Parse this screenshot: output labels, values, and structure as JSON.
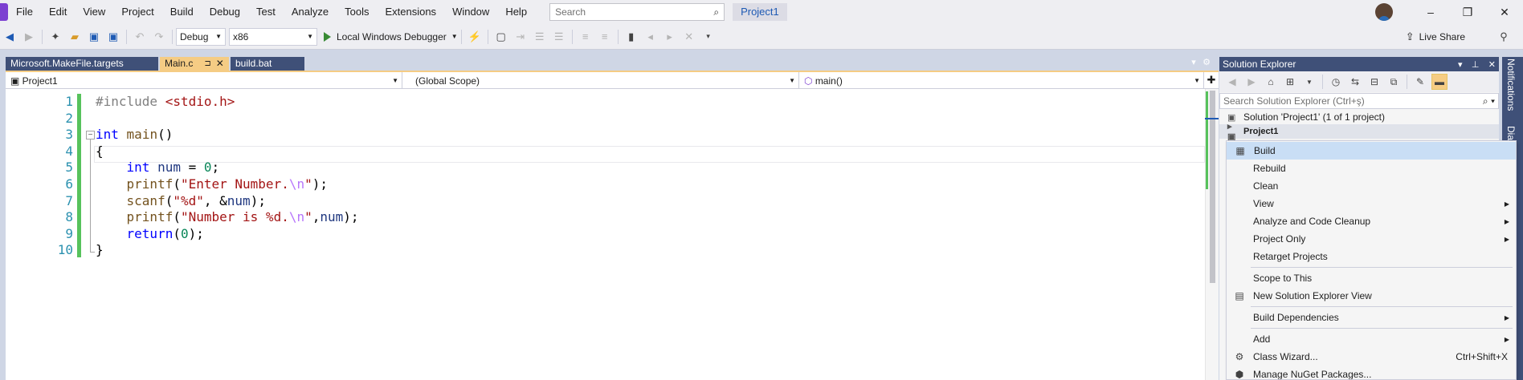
{
  "menubar": {
    "items": [
      "File",
      "Edit",
      "View",
      "Project",
      "Build",
      "Debug",
      "Test",
      "Analyze",
      "Tools",
      "Extensions",
      "Window",
      "Help"
    ],
    "search_placeholder": "Search",
    "project_title": "Project1"
  },
  "toolbar": {
    "configuration": "Debug",
    "platform": "x86",
    "debugger_label": "Local Windows Debugger",
    "live_share": "Live Share"
  },
  "tabs": [
    {
      "label": "Microsoft.MakeFile.targets"
    },
    {
      "label": "Main.c"
    },
    {
      "label": "build.bat"
    }
  ],
  "navbar": {
    "project": "Project1",
    "scope": "(Global Scope)",
    "member": "main()"
  },
  "editor": {
    "line_numbers": [
      "1",
      "2",
      "3",
      "4",
      "5",
      "6",
      "7",
      "8",
      "9",
      "10"
    ],
    "lines": [
      [
        {
          "t": "#include ",
          "c": "pre"
        },
        {
          "t": "<stdio.h>",
          "c": "str"
        }
      ],
      [],
      [
        {
          "t": "int",
          "c": "kw"
        },
        {
          "t": " ",
          "c": ""
        },
        {
          "t": "main",
          "c": "fn"
        },
        {
          "t": "()",
          "c": ""
        }
      ],
      [
        {
          "t": "{",
          "c": ""
        }
      ],
      [
        {
          "t": "    ",
          "c": ""
        },
        {
          "t": "int",
          "c": "kw"
        },
        {
          "t": " ",
          "c": ""
        },
        {
          "t": "num",
          "c": "var"
        },
        {
          "t": " = ",
          "c": ""
        },
        {
          "t": "0",
          "c": "num"
        },
        {
          "t": ";",
          "c": ""
        }
      ],
      [
        {
          "t": "    ",
          "c": ""
        },
        {
          "t": "printf",
          "c": "fn"
        },
        {
          "t": "(",
          "c": ""
        },
        {
          "t": "\"Enter Number.",
          "c": "str"
        },
        {
          "t": "\\n",
          "c": "esc"
        },
        {
          "t": "\"",
          "c": "str"
        },
        {
          "t": ");",
          "c": ""
        }
      ],
      [
        {
          "t": "    ",
          "c": ""
        },
        {
          "t": "scanf",
          "c": "fn"
        },
        {
          "t": "(",
          "c": ""
        },
        {
          "t": "\"%d\"",
          "c": "str"
        },
        {
          "t": ", &",
          "c": ""
        },
        {
          "t": "num",
          "c": "var"
        },
        {
          "t": ");",
          "c": ""
        }
      ],
      [
        {
          "t": "    ",
          "c": ""
        },
        {
          "t": "printf",
          "c": "fn"
        },
        {
          "t": "(",
          "c": ""
        },
        {
          "t": "\"Number is %d.",
          "c": "str"
        },
        {
          "t": "\\n",
          "c": "esc"
        },
        {
          "t": "\"",
          "c": "str"
        },
        {
          "t": ",",
          "c": ""
        },
        {
          "t": "num",
          "c": "var"
        },
        {
          "t": ");",
          "c": ""
        }
      ],
      [
        {
          "t": "    ",
          "c": ""
        },
        {
          "t": "return",
          "c": "kw"
        },
        {
          "t": "(",
          "c": ""
        },
        {
          "t": "0",
          "c": "num"
        },
        {
          "t": ");",
          "c": ""
        }
      ],
      [
        {
          "t": "}",
          "c": ""
        }
      ]
    ]
  },
  "solution_explorer": {
    "title": "Solution Explorer",
    "search_placeholder": "Search Solution Explorer (Ctrl+ş)",
    "solution_item": "Solution 'Project1' (1 of 1 project)",
    "project_item": "Project1"
  },
  "side_rail": {
    "notifications": "Notifications",
    "diagnostics": "Dia"
  },
  "context_menu": {
    "items": [
      {
        "label": "Build",
        "icon": "build-icon",
        "glyph": "▦",
        "hover": true
      },
      {
        "label": "Rebuild"
      },
      {
        "label": "Clean"
      },
      {
        "label": "View",
        "submenu": true
      },
      {
        "label": "Analyze and Code Cleanup",
        "submenu": true
      },
      {
        "label": "Project Only",
        "submenu": true
      },
      {
        "label": "Retarget Projects"
      },
      {
        "separator": true
      },
      {
        "label": "Scope to This"
      },
      {
        "label": "New Solution Explorer View",
        "icon": "new-view-icon",
        "glyph": "▤"
      },
      {
        "separator": true
      },
      {
        "label": "Build Dependencies",
        "submenu": true
      },
      {
        "separator": true
      },
      {
        "label": "Add",
        "submenu": true
      },
      {
        "label": "Class Wizard...",
        "icon": "class-wizard-icon",
        "glyph": "⚙",
        "shortcut": "Ctrl+Shift+X"
      },
      {
        "label": "Manage NuGet Packages...",
        "icon": "nuget-icon",
        "glyph": "⬢"
      }
    ]
  },
  "colors": {
    "accent_tab": "#f5cc84",
    "panel_header": "#3f5078",
    "menu_hover": "#c9def5",
    "change_bar": "#57c25c"
  }
}
